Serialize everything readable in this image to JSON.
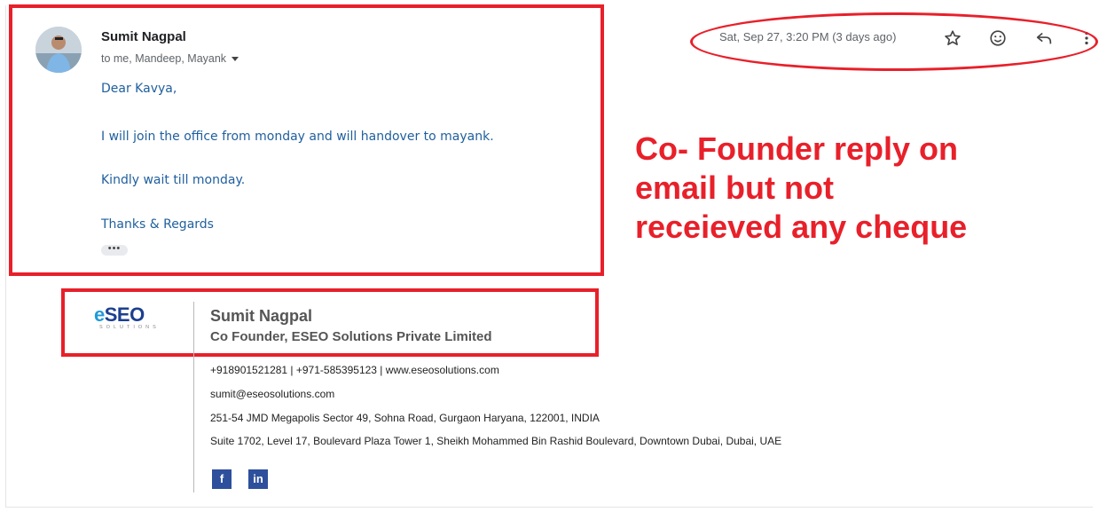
{
  "email": {
    "sender_name": "Sumit Nagpal",
    "recipients": "to me, Mandeep, Mayank",
    "date": "Sat, Sep 27, 3:20 PM (3 days ago)",
    "body": [
      "Dear Kavya,",
      "I will join the office from monday and will handover to mayank.",
      "Kindly wait till monday.",
      "Thanks & Regards"
    ],
    "more_label": "•••"
  },
  "header_icons": [
    "star-icon",
    "emoji-icon",
    "reply-icon",
    "more-vert-icon"
  ],
  "annotation": {
    "lines": [
      "Co- Founder reply on",
      "email but not",
      "receieved any cheque"
    ],
    "color": "#e8202a"
  },
  "signature": {
    "logo_text": "SEO",
    "logo_letter": "e",
    "logo_sub": "SOLUTIONS",
    "name": "Sumit Nagpal",
    "title": "Co Founder, ESEO Solutions Private Limited",
    "contact": "+918901521281  |  +971-585395123  |  www.eseosolutions.com",
    "email": "sumit@eseosolutions.com",
    "address_india": "251-54 JMD Megapolis Sector 49, Sohna Road, Gurgaon Haryana, 122001, INDIA",
    "address_dubai": "Suite 1702, Level 17, Boulevard Plaza Tower 1, Sheikh Mohammed Bin Rashid Boulevard, Downtown Dubai, Dubai, UAE",
    "social": [
      "f",
      "in"
    ]
  },
  "colors": {
    "body_text": "#1f5f9e",
    "brand_blue": "#1c3f8f",
    "social_blue": "#2e4f9c"
  }
}
